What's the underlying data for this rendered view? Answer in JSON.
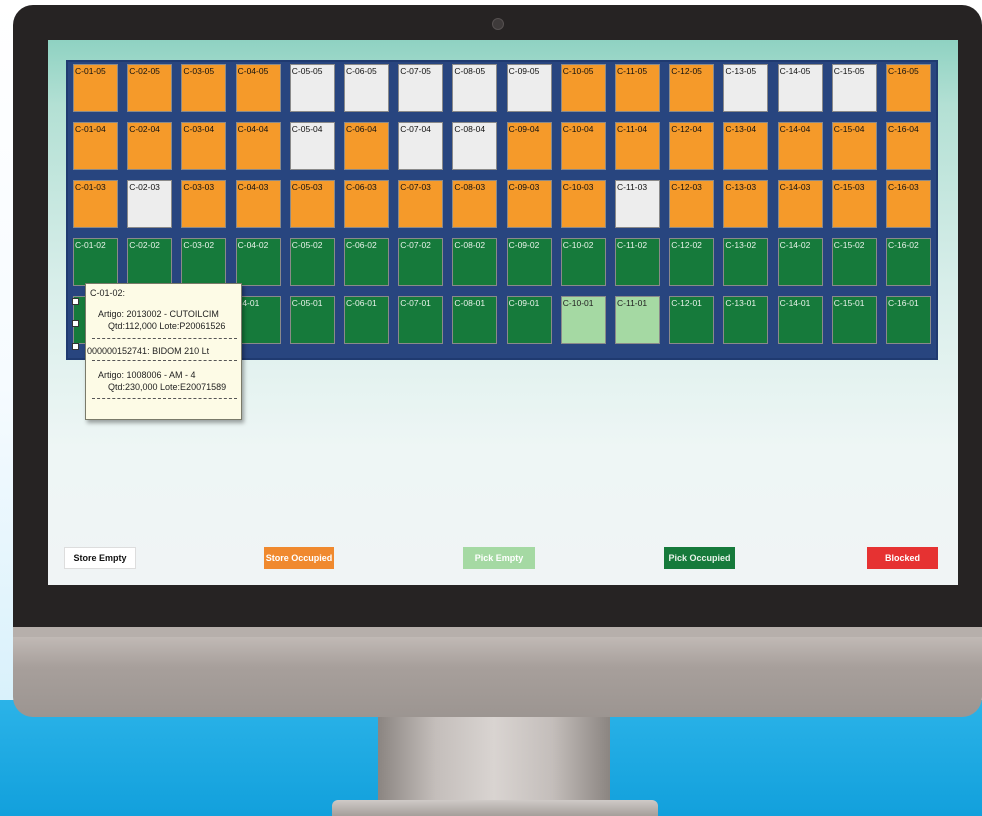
{
  "colors": {
    "store_empty": "#ededed",
    "store_occupied": "#f59a2a",
    "pick_empty": "#a5d9a3",
    "pick_occupied": "#167a3b",
    "blocked": "#e63232",
    "rack_frame": "#28457f"
  },
  "rack": {
    "rows": [
      {
        "level": "05",
        "cells": [
          {
            "label": "C-01-05",
            "status": "store_occupied"
          },
          {
            "label": "C-02-05",
            "status": "store_occupied"
          },
          {
            "label": "C-03-05",
            "status": "store_occupied"
          },
          {
            "label": "C-04-05",
            "status": "store_occupied"
          },
          {
            "label": "C-05-05",
            "status": "store_empty"
          },
          {
            "label": "C-06-05",
            "status": "store_empty"
          },
          {
            "label": "C-07-05",
            "status": "store_empty"
          },
          {
            "label": "C-08-05",
            "status": "store_empty"
          },
          {
            "label": "C-09-05",
            "status": "store_empty"
          },
          {
            "label": "C-10-05",
            "status": "store_occupied"
          },
          {
            "label": "C-11-05",
            "status": "store_occupied"
          },
          {
            "label": "C-12-05",
            "status": "store_occupied"
          },
          {
            "label": "C-13-05",
            "status": "store_empty"
          },
          {
            "label": "C-14-05",
            "status": "store_empty"
          },
          {
            "label": "C-15-05",
            "status": "store_empty"
          },
          {
            "label": "C-16-05",
            "status": "store_occupied"
          }
        ]
      },
      {
        "level": "04",
        "cells": [
          {
            "label": "C-01-04",
            "status": "store_occupied"
          },
          {
            "label": "C-02-04",
            "status": "store_occupied"
          },
          {
            "label": "C-03-04",
            "status": "store_occupied"
          },
          {
            "label": "C-04-04",
            "status": "store_occupied"
          },
          {
            "label": "C-05-04",
            "status": "store_empty"
          },
          {
            "label": "C-06-04",
            "status": "store_occupied"
          },
          {
            "label": "C-07-04",
            "status": "store_empty"
          },
          {
            "label": "C-08-04",
            "status": "store_empty"
          },
          {
            "label": "C-09-04",
            "status": "store_occupied"
          },
          {
            "label": "C-10-04",
            "status": "store_occupied"
          },
          {
            "label": "C-11-04",
            "status": "store_occupied"
          },
          {
            "label": "C-12-04",
            "status": "store_occupied"
          },
          {
            "label": "C-13-04",
            "status": "store_occupied"
          },
          {
            "label": "C-14-04",
            "status": "store_occupied"
          },
          {
            "label": "C-15-04",
            "status": "store_occupied"
          },
          {
            "label": "C-16-04",
            "status": "store_occupied"
          }
        ]
      },
      {
        "level": "03",
        "cells": [
          {
            "label": "C-01-03",
            "status": "store_occupied"
          },
          {
            "label": "C-02-03",
            "status": "store_empty"
          },
          {
            "label": "C-03-03",
            "status": "store_occupied"
          },
          {
            "label": "C-04-03",
            "status": "store_occupied"
          },
          {
            "label": "C-05-03",
            "status": "store_occupied"
          },
          {
            "label": "C-06-03",
            "status": "store_occupied"
          },
          {
            "label": "C-07-03",
            "status": "store_occupied"
          },
          {
            "label": "C-08-03",
            "status": "store_occupied"
          },
          {
            "label": "C-09-03",
            "status": "store_occupied"
          },
          {
            "label": "C-10-03",
            "status": "store_occupied"
          },
          {
            "label": "C-11-03",
            "status": "store_empty"
          },
          {
            "label": "C-12-03",
            "status": "store_occupied"
          },
          {
            "label": "C-13-03",
            "status": "store_occupied"
          },
          {
            "label": "C-14-03",
            "status": "store_occupied"
          },
          {
            "label": "C-15-03",
            "status": "store_occupied"
          },
          {
            "label": "C-16-03",
            "status": "store_occupied"
          }
        ]
      },
      {
        "level": "02",
        "cells": [
          {
            "label": "C-01-02",
            "status": "pick_occupied"
          },
          {
            "label": "C-02-02",
            "status": "pick_occupied"
          },
          {
            "label": "C-03-02",
            "status": "pick_occupied"
          },
          {
            "label": "C-04-02",
            "status": "pick_occupied"
          },
          {
            "label": "C-05-02",
            "status": "pick_occupied"
          },
          {
            "label": "C-06-02",
            "status": "pick_occupied"
          },
          {
            "label": "C-07-02",
            "status": "pick_occupied"
          },
          {
            "label": "C-08-02",
            "status": "pick_occupied"
          },
          {
            "label": "C-09-02",
            "status": "pick_occupied"
          },
          {
            "label": "C-10-02",
            "status": "pick_occupied"
          },
          {
            "label": "C-11-02",
            "status": "pick_occupied"
          },
          {
            "label": "C-12-02",
            "status": "pick_occupied"
          },
          {
            "label": "C-13-02",
            "status": "pick_occupied"
          },
          {
            "label": "C-14-02",
            "status": "pick_occupied"
          },
          {
            "label": "C-15-02",
            "status": "pick_occupied"
          },
          {
            "label": "C-16-02",
            "status": "pick_occupied"
          }
        ]
      },
      {
        "level": "01",
        "cells": [
          {
            "label": "",
            "status": "pick_occupied"
          },
          {
            "label": "",
            "status": "pick_occupied"
          },
          {
            "label": "",
            "status": "pick_occupied"
          },
          {
            "label": "04-01",
            "status": "pick_occupied"
          },
          {
            "label": "C-05-01",
            "status": "pick_occupied"
          },
          {
            "label": "C-06-01",
            "status": "pick_occupied"
          },
          {
            "label": "C-07-01",
            "status": "pick_occupied"
          },
          {
            "label": "C-08-01",
            "status": "pick_occupied"
          },
          {
            "label": "C-09-01",
            "status": "pick_occupied"
          },
          {
            "label": "C-10-01",
            "status": "pick_empty"
          },
          {
            "label": "C-11-01",
            "status": "pick_empty"
          },
          {
            "label": "C-12-01",
            "status": "pick_occupied"
          },
          {
            "label": "C-13-01",
            "status": "pick_occupied"
          },
          {
            "label": "C-14-01",
            "status": "pick_occupied"
          },
          {
            "label": "C-15-01",
            "status": "pick_occupied"
          },
          {
            "label": "C-16-01",
            "status": "pick_occupied"
          }
        ]
      }
    ]
  },
  "tooltip": {
    "title": "C-01-02:",
    "item1_line1": "Artigo: 2013002 - CUTOILCIM",
    "item1_line2": "Qtd:112,000 Lote:P20061526",
    "container": "000000152741: BIDOM 210 Lt",
    "item2_line1": "Artigo: 1008006 - AM - 4",
    "item2_line2": "Qtd:230,000 Lote:E20071589"
  },
  "legend": {
    "store_empty": "Store Empty",
    "store_occupied": "Store Occupied",
    "pick_empty": "Pick Empty",
    "pick_occupied": "Pick Occupied",
    "blocked": "Blocked"
  }
}
